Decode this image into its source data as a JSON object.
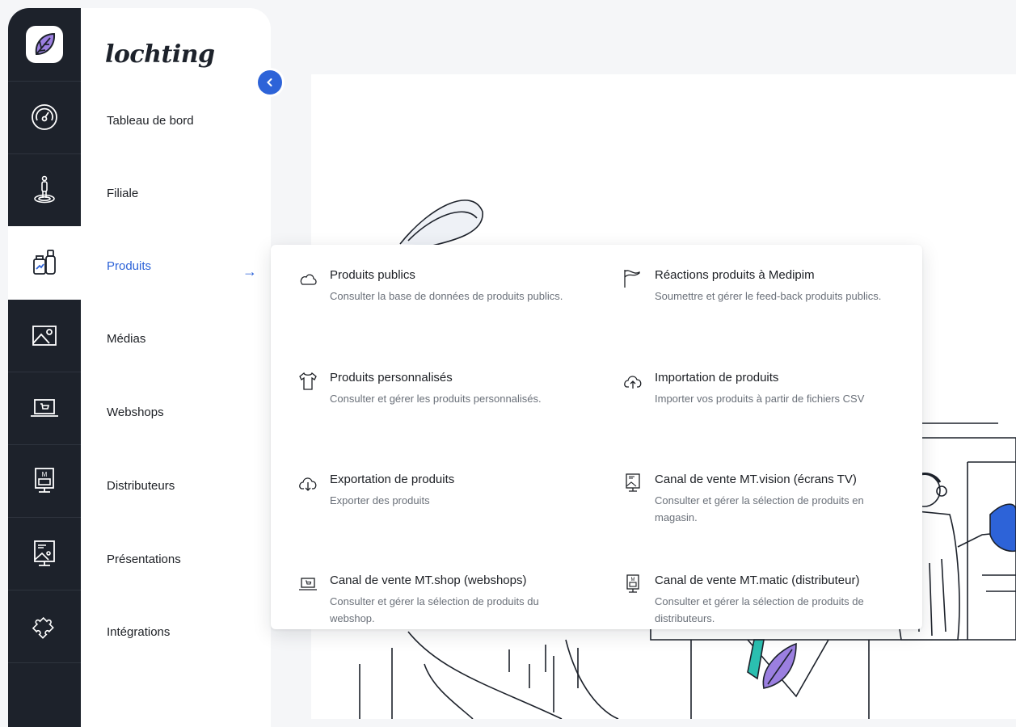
{
  "brand": {
    "name": "lochting"
  },
  "rail": {
    "items": [
      {
        "name": "logo",
        "icon": "leaf-logo-icon"
      },
      {
        "name": "dashboard",
        "icon": "gauge-icon"
      },
      {
        "name": "branch",
        "icon": "location-person-icon"
      },
      {
        "name": "products",
        "icon": "product-bottles-icon",
        "active": true
      },
      {
        "name": "media",
        "icon": "image-icon"
      },
      {
        "name": "webshops",
        "icon": "laptop-cart-icon"
      },
      {
        "name": "distributors",
        "icon": "vending-screen-icon"
      },
      {
        "name": "presentations",
        "icon": "presentation-board-icon"
      },
      {
        "name": "integrations",
        "icon": "puzzle-icon"
      }
    ]
  },
  "nav": {
    "items": [
      {
        "label": "Tableau de bord"
      },
      {
        "label": "Filiale"
      },
      {
        "label": "Produits",
        "active": true
      },
      {
        "label": "Médias"
      },
      {
        "label": "Webshops"
      },
      {
        "label": "Distributeurs"
      },
      {
        "label": "Présentations"
      },
      {
        "label": "Intégrations"
      }
    ],
    "arrow": "→",
    "collapse": "‹"
  },
  "menu": {
    "items": [
      {
        "title": "Produits publics",
        "desc": "Consulter la base de données de produits publics.",
        "icon": "cloud-icon"
      },
      {
        "title": "Réactions produits à Medipim",
        "desc": "Soumettre et gérer le feed-back produits publics.",
        "icon": "flag-icon"
      },
      {
        "title": "Produits personnalisés",
        "desc": "Consulter et gérer les produits personnalisés.",
        "icon": "tshirt-icon"
      },
      {
        "title": "Importation de produits",
        "desc": "Importer vos produits à partir de fichiers CSV",
        "icon": "cloud-upload-icon"
      },
      {
        "title": "Exportation de produits",
        "desc": "Exporter des produits",
        "icon": "cloud-download-icon"
      },
      {
        "title": "Canal de vente MT.vision (écrans TV)",
        "desc": "Consulter et gérer la sélection de produits en magasin.",
        "icon": "screen-stand-icon"
      },
      {
        "title": "Canal de vente MT.shop (webshops)",
        "desc": "Consulter et gérer la sélection de produits du webshop.",
        "icon": "laptop-cart-icon"
      },
      {
        "title": "Canal de vente MT.matic (distributeur)",
        "desc": "Consulter et gérer la sélection de produits de distributeurs.",
        "icon": "vending-machine-icon"
      }
    ]
  },
  "colors": {
    "rail_bg": "#1d222b",
    "accent": "#2d63d8",
    "text": "#1c1f24",
    "muted": "#6a7079",
    "leaf_purple": "#9b7fe0",
    "illustration_teal": "#2bbfb0",
    "illustration_blue": "#2d63d8"
  }
}
